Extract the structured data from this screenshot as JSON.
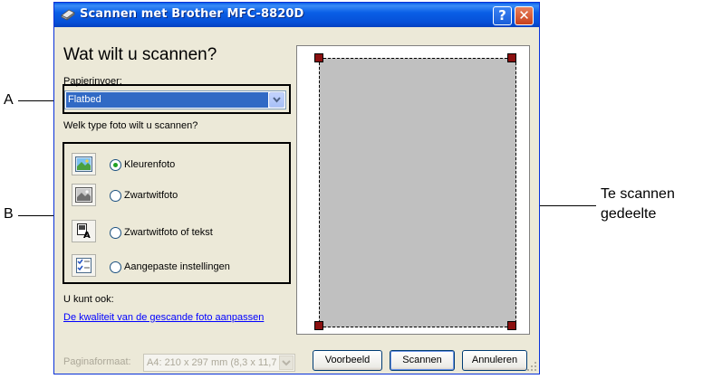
{
  "window": {
    "title": "Scannen met Brother MFC-8820D",
    "help_label": "?",
    "close_label": "✕",
    "title_icon": "scanner-icon"
  },
  "form": {
    "heading": "Wat wilt u scannen?",
    "paper_feed_label": "Papierinvoer:",
    "paper_feed_value": "Flatbed",
    "photo_type_question": "Welk type foto wilt u scannen?",
    "options": [
      {
        "label": "Kleurenfoto",
        "icon": "color-photo-icon",
        "selected": true
      },
      {
        "label": "Zwartwitfoto",
        "icon": "grayscale-photo-icon",
        "selected": false
      },
      {
        "label": "Zwartwitfoto of tekst",
        "icon": "bw-text-icon",
        "selected": false
      },
      {
        "label": "Aangepaste instellingen",
        "icon": "custom-settings-icon",
        "selected": false
      }
    ],
    "also_label": "U kunt ook:",
    "quality_link": "De kwaliteit van de gescande foto aanpassen",
    "page_size_label": "Paginaformaat:",
    "page_size_value": "A4: 210 x 297 mm (8,3 x 11,7"
  },
  "buttons": {
    "preview": "Voorbeeld",
    "scan": "Scannen",
    "cancel": "Annuleren"
  },
  "callouts": {
    "a": "A",
    "b": "B",
    "area_line1": "Te scannen",
    "area_line2": "gedeelte"
  }
}
